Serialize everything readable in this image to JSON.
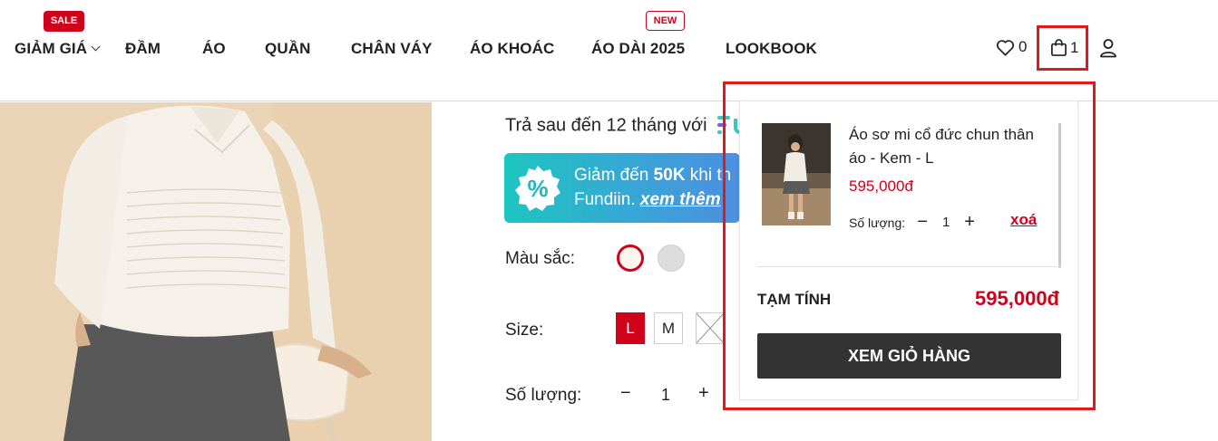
{
  "nav": {
    "items": [
      {
        "label": "GIẢM GIÁ",
        "badge": "SALE"
      },
      {
        "label": "ĐẦM"
      },
      {
        "label": "ÁO"
      },
      {
        "label": "QUẦN"
      },
      {
        "label": "CHÂN VÁY"
      },
      {
        "label": "ÁO KHOÁC"
      },
      {
        "label": "ÁO DÀI 2025",
        "badge": "NEW"
      },
      {
        "label": "LOOKBOOK"
      }
    ],
    "wishlist_count": "0",
    "cart_count": "1",
    "icons": {
      "wishlist": "heart-icon",
      "cart": "shopping-bag-icon",
      "account": "user-icon"
    }
  },
  "product": {
    "pay_later_text": "Trả sau đến 12 tháng với",
    "promo": {
      "line1_prefix": "Giảm đến ",
      "line1_amount": "50K",
      "line1_suffix": " khi th",
      "line2_prefix": "Fundiin. ",
      "line2_link": "xem thêm"
    },
    "color_label": "Màu sắc:",
    "colors": [
      {
        "name": "cream",
        "hex": "#fbf6ee",
        "selected": true
      },
      {
        "name": "grey",
        "hex": "#dcdcdc",
        "selected": false
      }
    ],
    "size_label": "Size:",
    "sizes": [
      {
        "label": "L",
        "selected": true,
        "available": true
      },
      {
        "label": "M",
        "selected": false,
        "available": true
      },
      {
        "label": "",
        "selected": false,
        "available": false
      }
    ],
    "quantity_label": "Số lượng:",
    "quantity": "1",
    "minus": "−",
    "plus": "+"
  },
  "cart_dropdown": {
    "item": {
      "name": "Áo sơ mi cổ đức chun thân áo - Kem - L",
      "price": "595,000đ",
      "qty_label": "Số lượng:",
      "qty": "1",
      "minus": "−",
      "plus": "+",
      "remove_label": "xoá"
    },
    "subtotal_label": "TẠM TÍNH",
    "subtotal_value": "595,000đ",
    "view_cart_label": "XEM GIỎ HÀNG"
  },
  "colors": {
    "accent_red": "#d0021b",
    "highlight_red": "#e01a1a",
    "button_dark": "#333333"
  }
}
